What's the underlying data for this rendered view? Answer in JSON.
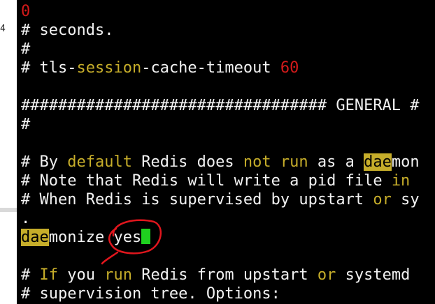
{
  "left_window": {
    "number_fragment": "4"
  },
  "terminal": {
    "lines": [
      {
        "segments": [
          {
            "t": "0",
            "c": "r"
          }
        ]
      },
      {
        "segments": [
          {
            "t": "# seconds.",
            "c": ""
          }
        ]
      },
      {
        "segments": [
          {
            "t": "#",
            "c": ""
          }
        ]
      },
      {
        "segments": [
          {
            "t": "# tls-",
            "c": ""
          },
          {
            "t": "session",
            "c": "y"
          },
          {
            "t": "-cache-timeout ",
            "c": ""
          },
          {
            "t": "60",
            "c": "r"
          }
        ]
      },
      {
        "segments": []
      },
      {
        "segments": [
          {
            "t": "################################# GENERAL #",
            "c": ""
          }
        ]
      },
      {
        "segments": [
          {
            "t": "#",
            "c": ""
          }
        ]
      },
      {
        "segments": []
      },
      {
        "segments": [
          {
            "t": "# By ",
            "c": ""
          },
          {
            "t": "default",
            "c": "y"
          },
          {
            "t": " Redis does ",
            "c": ""
          },
          {
            "t": "not",
            "c": "y"
          },
          {
            "t": " ",
            "c": ""
          },
          {
            "t": "run",
            "c": "y"
          },
          {
            "t": " as a ",
            "c": ""
          },
          {
            "t": "dae",
            "c": "hl"
          },
          {
            "t": "mon",
            "c": ""
          }
        ]
      },
      {
        "segments": [
          {
            "t": "# Note that Redis will write a pid file ",
            "c": ""
          },
          {
            "t": "in",
            "c": "y"
          }
        ]
      },
      {
        "segments": [
          {
            "t": "# When Redis is supervised by upstart ",
            "c": ""
          },
          {
            "t": "or",
            "c": "y"
          },
          {
            "t": " sy",
            "c": ""
          }
        ]
      },
      {
        "segments": [
          {
            "t": ".",
            "c": ""
          }
        ]
      },
      {
        "segments": [
          {
            "t": "dae",
            "c": "hl"
          },
          {
            "t": "monize yes",
            "c": ""
          }
        ],
        "cursor": true
      },
      {
        "segments": []
      },
      {
        "segments": [
          {
            "t": "# ",
            "c": ""
          },
          {
            "t": "If",
            "c": "y"
          },
          {
            "t": " you ",
            "c": ""
          },
          {
            "t": "run",
            "c": "y"
          },
          {
            "t": " Redis from upstart ",
            "c": ""
          },
          {
            "t": "or",
            "c": "y"
          },
          {
            "t": " systemd",
            "c": ""
          }
        ]
      },
      {
        "segments": [
          {
            "t": "# supervision tree. Options:",
            "c": ""
          }
        ]
      }
    ]
  },
  "colors": {
    "keyword": "#c6ad2a",
    "number": "#d41a1a",
    "cursor": "#1fd11f",
    "annotation": "#e0161d"
  }
}
